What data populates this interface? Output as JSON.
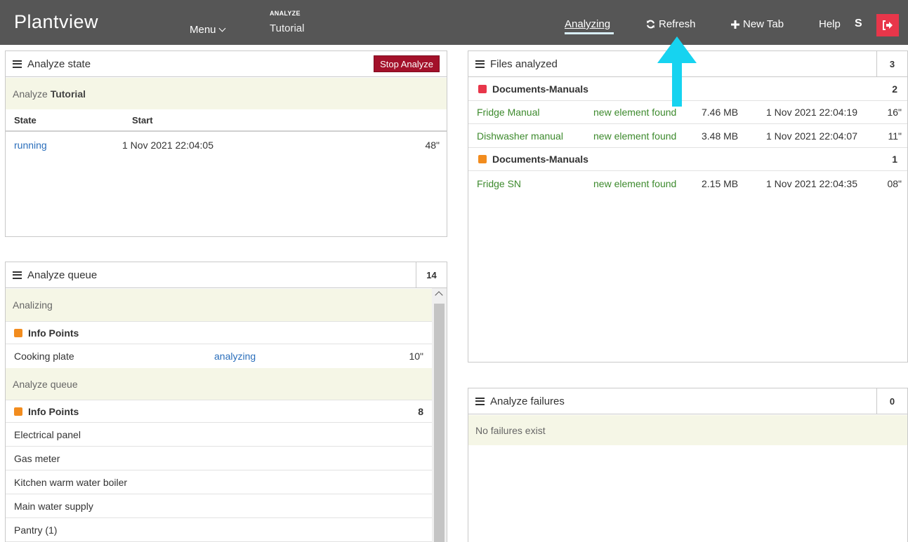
{
  "app": {
    "brand": "Plantview"
  },
  "topbar": {
    "menu_label": "Menu",
    "section_label": "ANALYZE",
    "section_name": "Tutorial",
    "nav_analyzing": "Analyzing",
    "nav_refresh": "Refresh",
    "nav_new_tab": "New Tab",
    "nav_help": "Help",
    "user_initial": "S"
  },
  "analyze_state": {
    "title": "Analyze state",
    "stop_button": "Stop Analyze",
    "banner_prefix": "Analyze",
    "banner_name": "Tutorial",
    "col_state": "State",
    "col_start": "Start",
    "rows": [
      {
        "state": "running",
        "start": "1 Nov 2021 22:04:05",
        "duration": "48\""
      }
    ]
  },
  "analyze_queue": {
    "title": "Analyze queue",
    "count": "14",
    "analyzing_label": "Analizing",
    "group1": {
      "name": "Info Points",
      "color": "#f28c1e"
    },
    "current": {
      "name": "Cooking plate",
      "status": "analyzing",
      "duration": "10\""
    },
    "queue_label": "Analyze queue",
    "group2": {
      "name": "Info Points",
      "count": "8",
      "color": "#f28c1e"
    },
    "items": [
      "Electrical panel",
      "Gas meter",
      "Kitchen warm water boiler",
      "Main water supply",
      "Pantry (1)"
    ]
  },
  "files_analyzed": {
    "title": "Files analyzed",
    "count": "3",
    "groups": [
      {
        "name": "Documents-Manuals",
        "count": "2",
        "color": "#e8364a",
        "files": [
          {
            "name": "Fridge Manual",
            "status": "new element found",
            "size": "7.46 MB",
            "date": "1 Nov 2021 22:04:19",
            "duration": "16\""
          },
          {
            "name": "Dishwasher manual",
            "status": "new element found",
            "size": "3.48 MB",
            "date": "1 Nov 2021 22:04:07",
            "duration": "11\""
          }
        ]
      },
      {
        "name": "Documents-Manuals",
        "count": "1",
        "color": "#f28c1e",
        "files": [
          {
            "name": "Fridge SN",
            "status": "new element found",
            "size": "2.15 MB",
            "date": "1 Nov 2021 22:04:35",
            "duration": "08\""
          }
        ]
      }
    ]
  },
  "analyze_failures": {
    "title": "Analyze failures",
    "count": "0",
    "empty_message": "No failures exist"
  },
  "colors": {
    "topbar": "#565656",
    "accent_red": "#a3112a",
    "logout": "#e8364a",
    "link_blue": "#2a6ebb",
    "status_green": "#3d8a2d",
    "highlight_arrow": "#16d3f0"
  }
}
